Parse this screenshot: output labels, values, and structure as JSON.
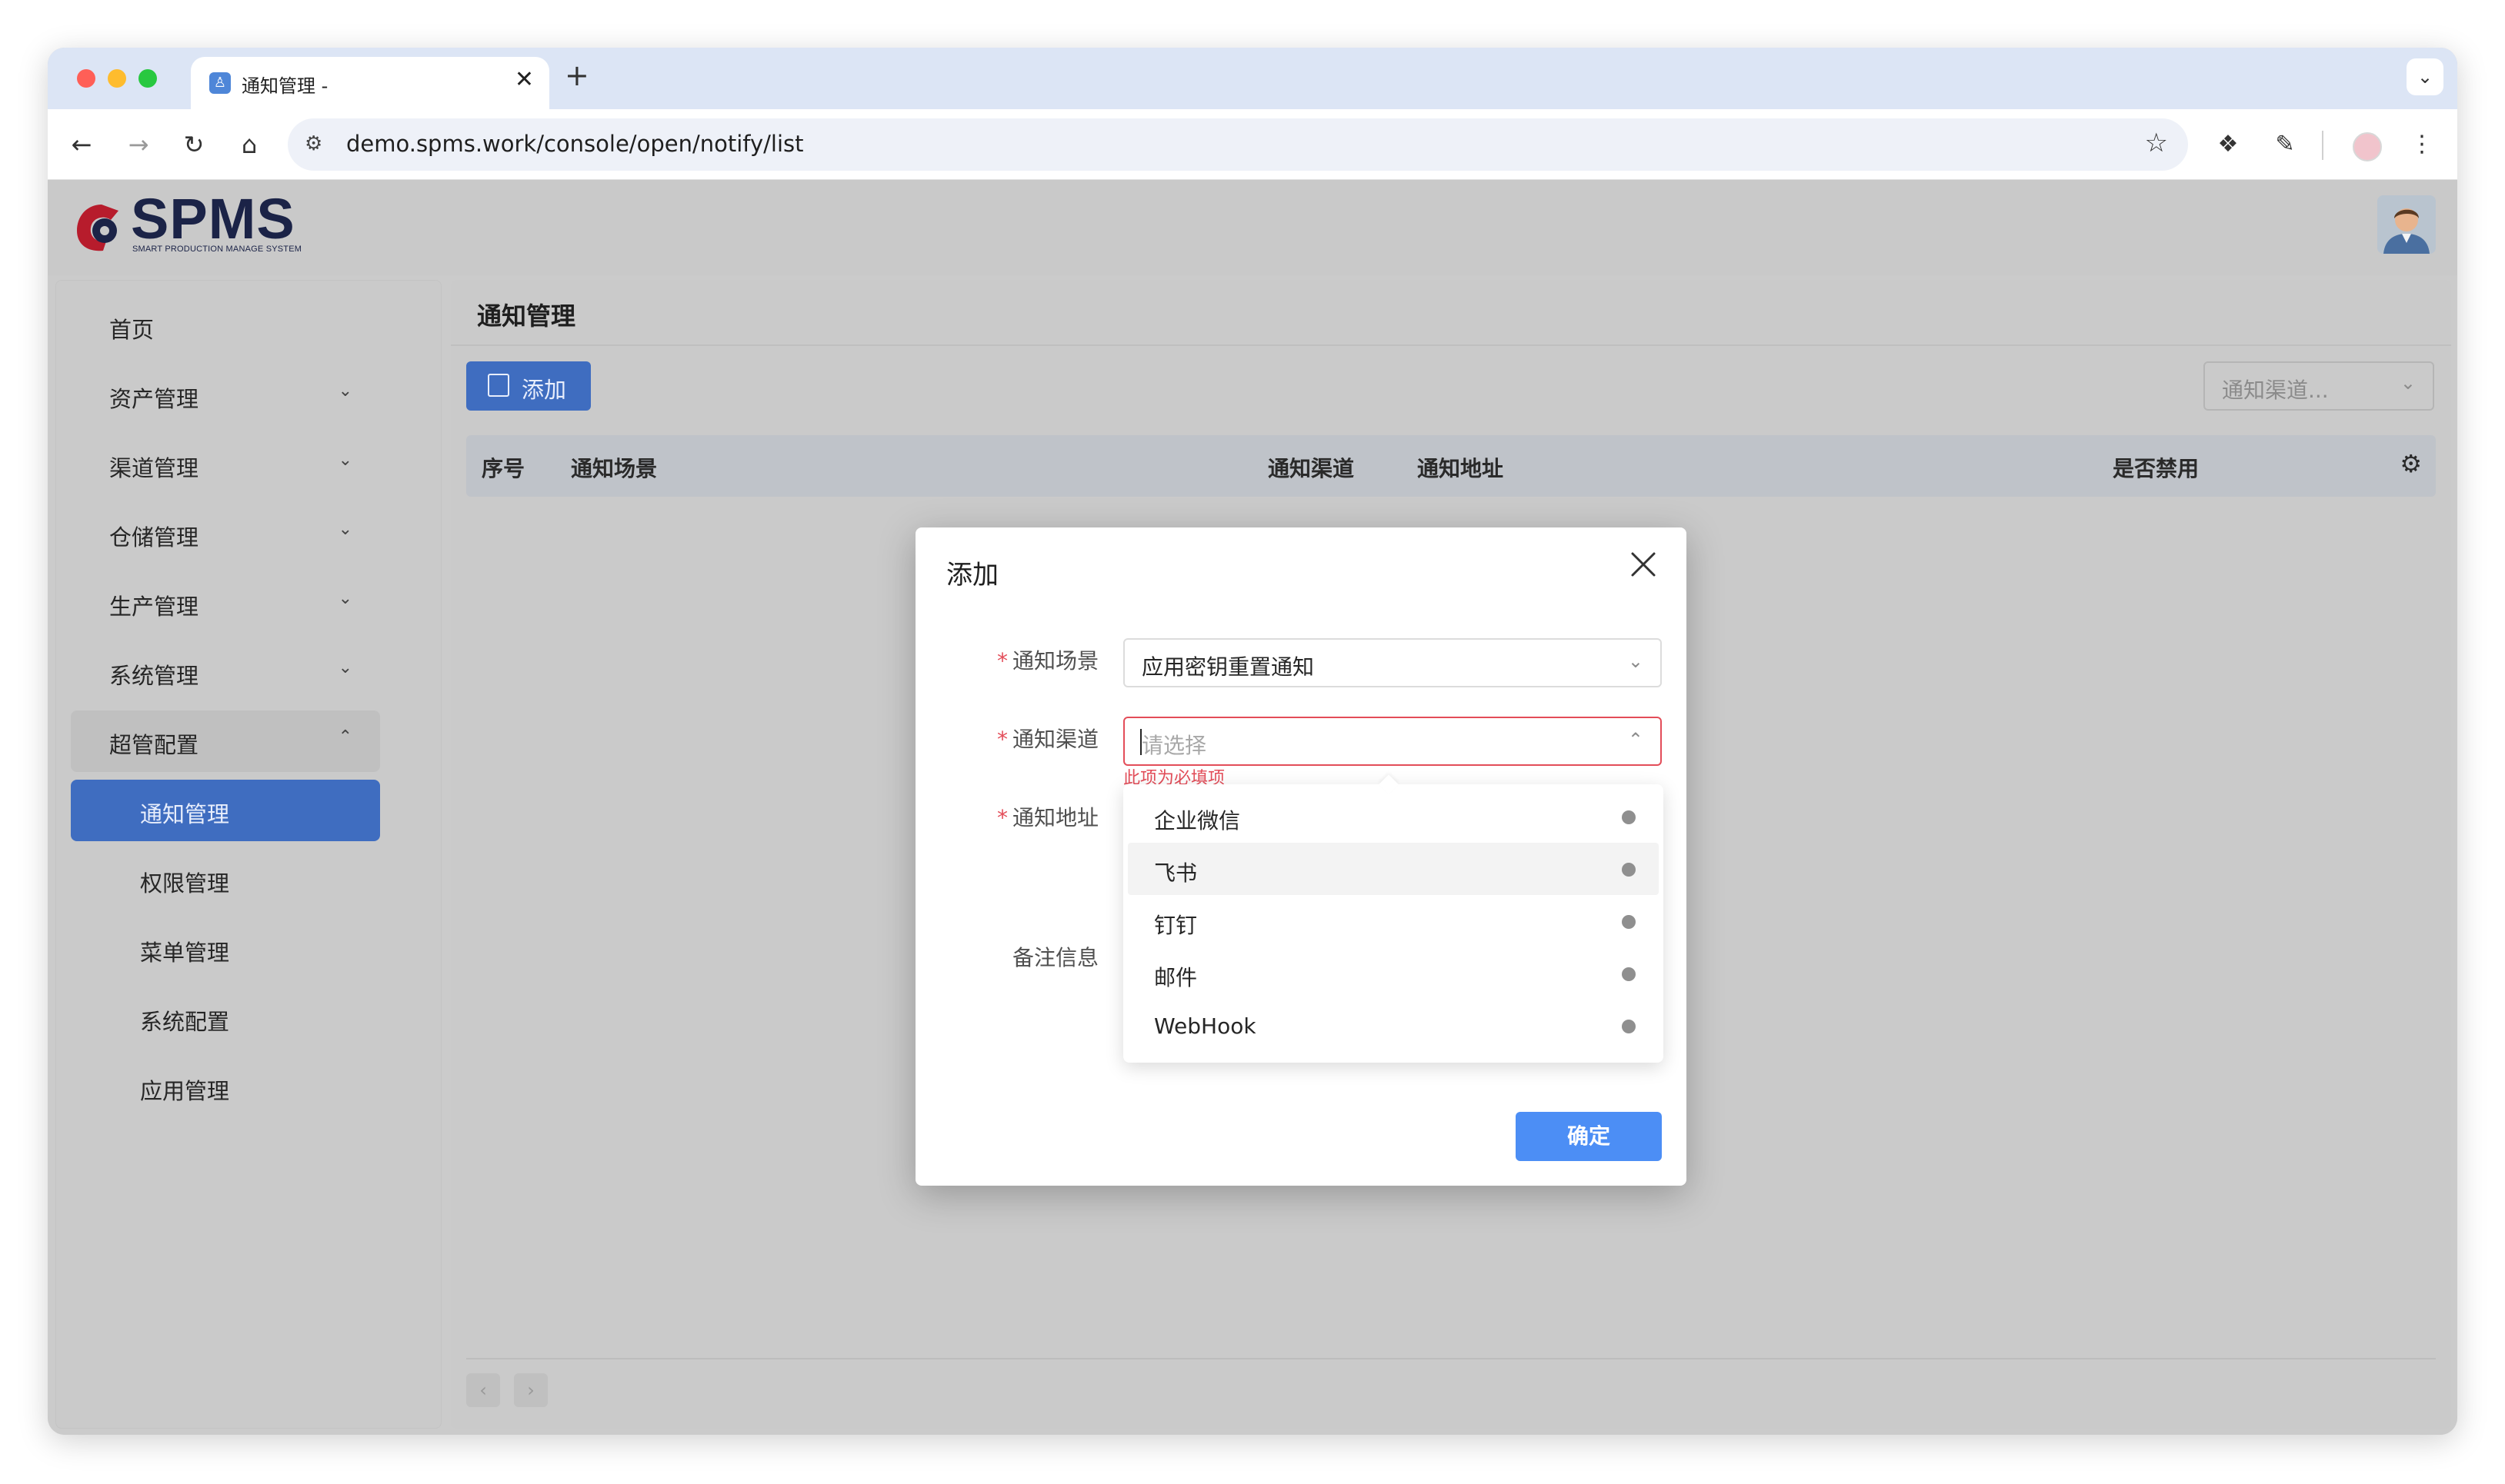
{
  "browser": {
    "tab_title": "通知管理 -",
    "tab_close": "✕",
    "new_tab": "+",
    "tab_menu": "⌄",
    "url": "demo.spms.work/console/open/notify/list",
    "icons": [
      "back-icon",
      "forward-icon",
      "reload-icon",
      "home-icon",
      "site-settings-icon",
      "bookmark-star-icon",
      "extension-icon",
      "puzzle-icon",
      "profile-icon",
      "more-menu-icon"
    ]
  },
  "app": {
    "logo_text": "SPMS",
    "logo_subtitle": "SMART PRODUCTION MANAGE SYSTEM"
  },
  "sidebar": {
    "items": [
      {
        "label": "首页",
        "chevron": ""
      },
      {
        "label": "资产管理",
        "chevron": "⌄"
      },
      {
        "label": "渠道管理",
        "chevron": "⌄"
      },
      {
        "label": "仓储管理",
        "chevron": "⌄"
      },
      {
        "label": "生产管理",
        "chevron": "⌄"
      },
      {
        "label": "系统管理",
        "chevron": "⌄"
      },
      {
        "label": "超管配置",
        "chevron": "⌃"
      }
    ],
    "sub_items": [
      {
        "label": "通知管理",
        "active": true
      },
      {
        "label": "权限管理"
      },
      {
        "label": "菜单管理"
      },
      {
        "label": "系统配置"
      },
      {
        "label": "应用管理"
      }
    ]
  },
  "main": {
    "page_title": "通知管理",
    "add_button": "添加",
    "filter_placeholder": "通知渠道...",
    "table_headers": [
      "序号",
      "通知场景",
      "通知渠道",
      "通知地址",
      "是否禁用"
    ],
    "pager_prev": "‹",
    "pager_next": "›"
  },
  "modal": {
    "title": "添加",
    "fields": [
      {
        "label": "通知场景",
        "required": "*",
        "value": "应用密钥重置通知"
      },
      {
        "label": "通知渠道",
        "required": "*",
        "placeholder": "请选择",
        "error": "此项为必填项"
      },
      {
        "label": "通知地址",
        "required": "*"
      },
      {
        "label": "备注信息",
        "required": ""
      }
    ],
    "channel_options": [
      "企业微信",
      "飞书",
      "钉钉",
      "邮件",
      "WebHook"
    ],
    "confirm_button": "确定"
  },
  "colors": {
    "accent": "#3f6dc0",
    "confirm": "#4c8ef5",
    "error": "#e34d59"
  }
}
